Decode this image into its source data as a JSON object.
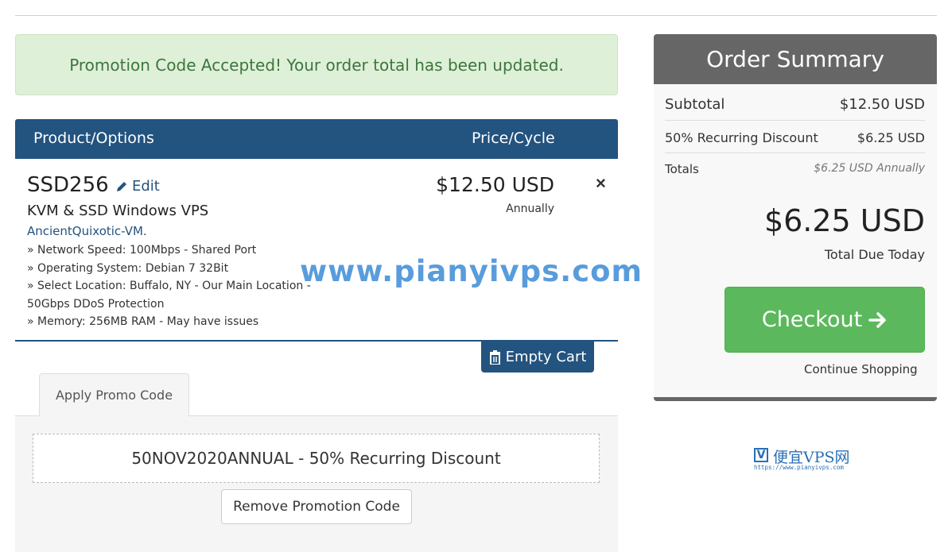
{
  "alert": {
    "message": "Promotion Code Accepted! Your order total has been updated."
  },
  "table": {
    "header_product": "Product/Options",
    "header_price": "Price/Cycle"
  },
  "item": {
    "name": "SSD256",
    "edit_label": "Edit",
    "group": "KVM & SSD Windows VPS",
    "domain": "AncientQuixotic-VM.",
    "price": "$12.50 USD",
    "cycle": "Annually",
    "remove_symbol": "×",
    "config": [
      "Network Speed: 100Mbps - Shared Port",
      "Operating System: Debian 7 32Bit",
      "Select Location: Buffalo, NY - Our Main Location - 50Gbps DDoS Protection",
      "Memory: 256MB RAM - May have issues"
    ]
  },
  "cart": {
    "empty_label": "Empty Cart"
  },
  "promo": {
    "tab_label": "Apply Promo Code",
    "applied_text": "50NOV2020ANNUAL - 50% Recurring Discount",
    "remove_label": "Remove Promotion Code"
  },
  "watermark": {
    "text": "www.pianyivps.com"
  },
  "summary": {
    "title": "Order Summary",
    "subtotal_label": "Subtotal",
    "subtotal_value": "$12.50 USD",
    "discount_label": "50% Recurring Discount",
    "discount_value": "$6.25 USD",
    "totals_label": "Totals",
    "totals_value": "$6.25 USD Annually",
    "total_amount": "$6.25 USD",
    "total_label": "Total Due Today",
    "checkout_label": "Checkout",
    "continue_label": "Continue Shopping"
  },
  "logo": {
    "mark": "V",
    "name": "便宜VPS网",
    "url": "https://www.pianyivps.com"
  },
  "colors": {
    "primary": "#23537f",
    "success": "#5cb85c",
    "alert_bg": "#dff0d8",
    "alert_text": "#3c763d",
    "summary_head": "#666666"
  },
  "icons": {
    "edit": "pencil-icon",
    "remove": "close-icon",
    "empty_cart": "trash-icon",
    "checkout": "arrow-right-icon"
  }
}
